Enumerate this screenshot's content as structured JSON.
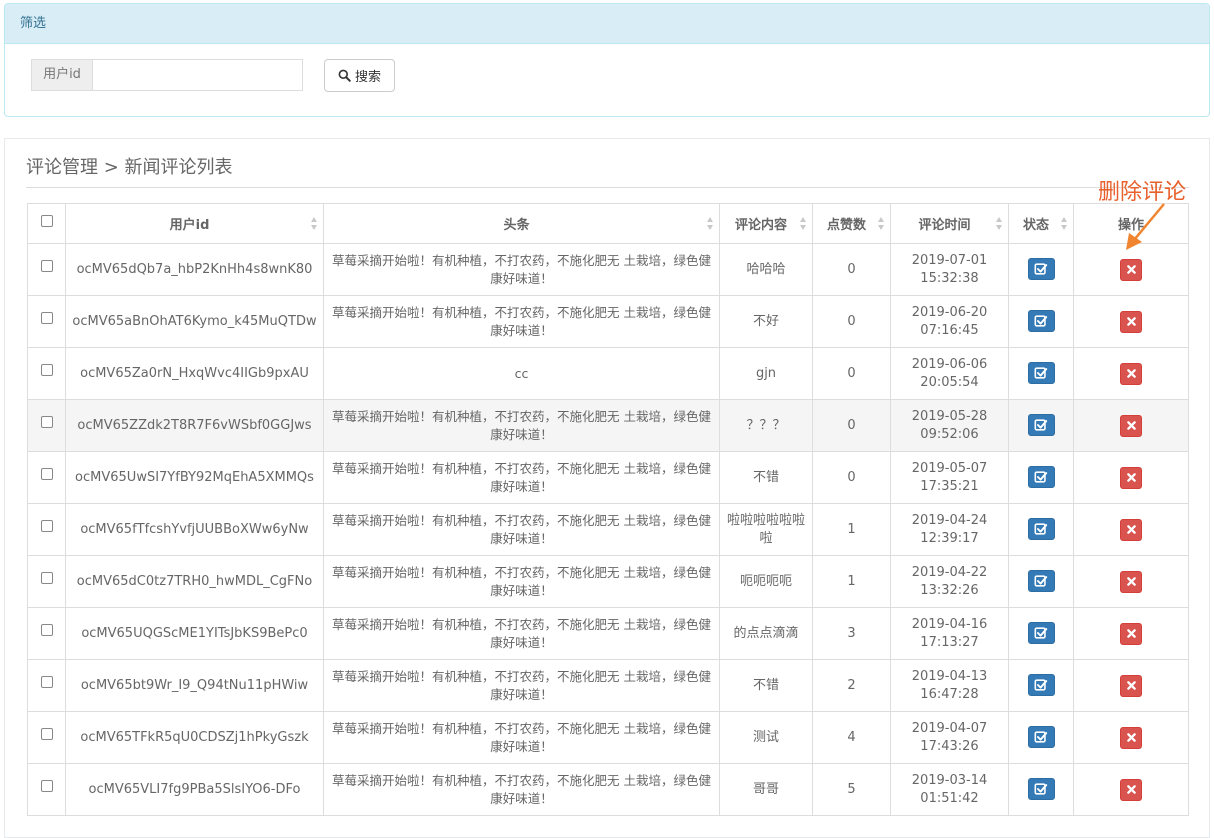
{
  "filter": {
    "heading": "筛选",
    "field_label": "用户id",
    "field_value": "",
    "search_label": "搜索"
  },
  "breadcrumb": "评论管理 > 新闻评论列表",
  "annotation": "删除评论",
  "colors": {
    "accent_primary": "#337ab7",
    "accent_danger": "#d9534f",
    "annotation": "#e8602c",
    "info_panel": "#d9edf7"
  },
  "icons": {
    "search": "magnifier-icon",
    "edit": "check-square-icon",
    "delete": "times-icon"
  },
  "table": {
    "headers": [
      "用户id",
      "头条",
      "评论内容",
      "点赞数",
      "评论时间",
      "状态",
      "操作"
    ],
    "rows": [
      {
        "user_id": "ocMV65dQb7a_hbP2KnHh4s8wnK80",
        "headline": "草莓采摘开始啦！有机种植，不打农药，不施化肥无 土栽培，绿色健康好味道！",
        "content": "哈哈哈",
        "likes": "0",
        "date": "2019-07-01",
        "time": "15:32:38"
      },
      {
        "user_id": "ocMV65aBnOhAT6Kymo_k45MuQTDw",
        "headline": "草莓采摘开始啦！有机种植，不打农药，不施化肥无 土栽培，绿色健康好味道！",
        "content": "不好",
        "likes": "0",
        "date": "2019-06-20",
        "time": "07:16:45"
      },
      {
        "user_id": "ocMV65Za0rN_HxqWvc4IIGb9pxAU",
        "headline": "cc",
        "content": "gjn",
        "likes": "0",
        "date": "2019-06-06",
        "time": "20:05:54"
      },
      {
        "user_id": "ocMV65ZZdk2T8R7F6vWSbf0GGJws",
        "headline": "草莓采摘开始啦！有机种植，不打农药，不施化肥无 土栽培，绿色健康好味道！",
        "content": "？？？",
        "likes": "0",
        "date": "2019-05-28",
        "time": "09:52:06"
      },
      {
        "user_id": "ocMV65UwSI7YfBY92MqEhA5XMMQs",
        "headline": "草莓采摘开始啦！有机种植，不打农药，不施化肥无 土栽培，绿色健康好味道！",
        "content": "不错",
        "likes": "0",
        "date": "2019-05-07",
        "time": "17:35:21"
      },
      {
        "user_id": "ocMV65fTfcshYvfjUUBBoXWw6yNw",
        "headline": "草莓采摘开始啦！有机种植，不打农药，不施化肥无 土栽培，绿色健康好味道！",
        "content": "啦啦啦啦啦啦啦",
        "likes": "1",
        "date": "2019-04-24",
        "time": "12:39:17"
      },
      {
        "user_id": "ocMV65dC0tz7TRH0_hwMDL_CgFNo",
        "headline": "草莓采摘开始啦！有机种植，不打农药，不施化肥无 土栽培，绿色健康好味道！",
        "content": "呃呃呃呃",
        "likes": "1",
        "date": "2019-04-22",
        "time": "13:32:26"
      },
      {
        "user_id": "ocMV65UQGScME1YITsJbKS9BePc0",
        "headline": "草莓采摘开始啦！有机种植，不打农药，不施化肥无 土栽培，绿色健康好味道！",
        "content": "的点点滴滴",
        "likes": "3",
        "date": "2019-04-16",
        "time": "17:13:27"
      },
      {
        "user_id": "ocMV65bt9Wr_I9_Q94tNu11pHWiw",
        "headline": "草莓采摘开始啦！有机种植，不打农药，不施化肥无 土栽培，绿色健康好味道！",
        "content": "不错",
        "likes": "2",
        "date": "2019-04-13",
        "time": "16:47:28"
      },
      {
        "user_id": "ocMV65TFkR5qU0CDSZj1hPkyGszk",
        "headline": "草莓采摘开始啦！有机种植，不打农药，不施化肥无 土栽培，绿色健康好味道！",
        "content": "测试",
        "likes": "4",
        "date": "2019-04-07",
        "time": "17:43:26"
      },
      {
        "user_id": "ocMV65VLI7fg9PBa5SlsIYO6-DFo",
        "headline": "草莓采摘开始啦！有机种植，不打农药，不施化肥无 土栽培，绿色健康好味道！",
        "content": "哥哥",
        "likes": "5",
        "date": "2019-03-14",
        "time": "01:51:42"
      }
    ]
  }
}
